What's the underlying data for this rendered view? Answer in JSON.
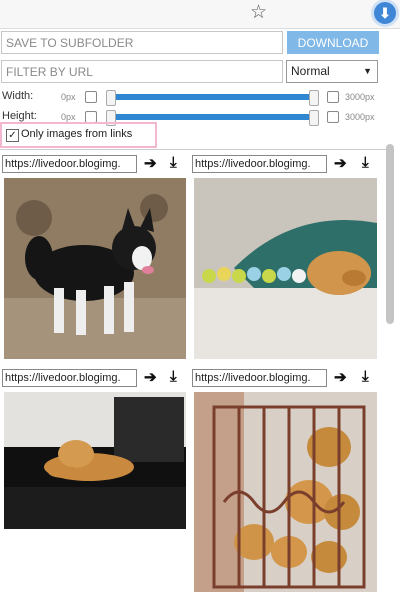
{
  "toolbar": {
    "star_icon": "star-icon",
    "extension_icon": "download-extension-icon"
  },
  "controls": {
    "subfolder_placeholder": "SAVE TO SUBFOLDER",
    "download_label": "DOWNLOAD",
    "filter_placeholder": "FILTER BY URL",
    "filter_mode": "Normal"
  },
  "dimensions": {
    "width_label": "Width:",
    "height_label": "Height:",
    "min_label": "0px",
    "max_label": "3000px"
  },
  "only_links": {
    "label": "Only images from links",
    "checked": true
  },
  "images": [
    {
      "url": "https://livedoor.blogimg.",
      "description": "husky puppy standing on ground"
    },
    {
      "url": "https://livedoor.blogimg.",
      "description": "golden retriever under blanket with toy birds"
    },
    {
      "url": "https://livedoor.blogimg.",
      "description": "golden retriever lying on dark floor"
    },
    {
      "url": "https://livedoor.blogimg.",
      "description": "golden retriever puppies behind gate"
    }
  ],
  "colors": {
    "accent": "#2f86d1",
    "download_button": "#80b8e8",
    "highlight_border": "#f3b8cf"
  }
}
